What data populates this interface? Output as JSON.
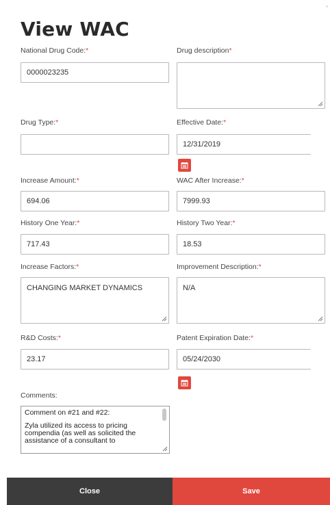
{
  "title": "View WAC",
  "required_marker": "*",
  "fields": {
    "ndc": {
      "label": "National Drug Code:",
      "value": "0000023235"
    },
    "drug_description": {
      "label": "Drug description",
      "value": ""
    },
    "drug_type": {
      "label": "Drug Type:",
      "value": ""
    },
    "effective_date": {
      "label": "Effective Date:",
      "value": "12/31/2019"
    },
    "increase_amount": {
      "label": "Increase Amount:",
      "value": "694.06"
    },
    "wac_after_increase": {
      "label": "WAC After Increase:",
      "value": "7999.93"
    },
    "history_one_year": {
      "label": "History One Year:",
      "value": "717.43"
    },
    "history_two_year": {
      "label": "History Two Year:",
      "value": "18.53"
    },
    "increase_factors": {
      "label": "Increase Factors:",
      "value": "CHANGING MARKET DYNAMICS"
    },
    "improvement_description": {
      "label": "Improvement Description:",
      "value": "N/A"
    },
    "rd_costs": {
      "label": "R&D Costs:",
      "value": "23.17"
    },
    "patent_expiration_date": {
      "label": "Patent Expiration Date:",
      "value": "05/24/2030"
    }
  },
  "comments": {
    "label": "Comments:",
    "line1": "Comment on  #21 and #22:",
    "line2": "Zyla utilized its access to pricing compendia (as well as solicited the assistance of a consultant to"
  },
  "footer": {
    "close_label": "Close",
    "save_label": "Save"
  },
  "colors": {
    "accent": "#e0483e",
    "close_bg": "#3c3c3c"
  },
  "icons": {
    "calendar": "calendar-icon",
    "resize": "resize-handle-icon"
  }
}
